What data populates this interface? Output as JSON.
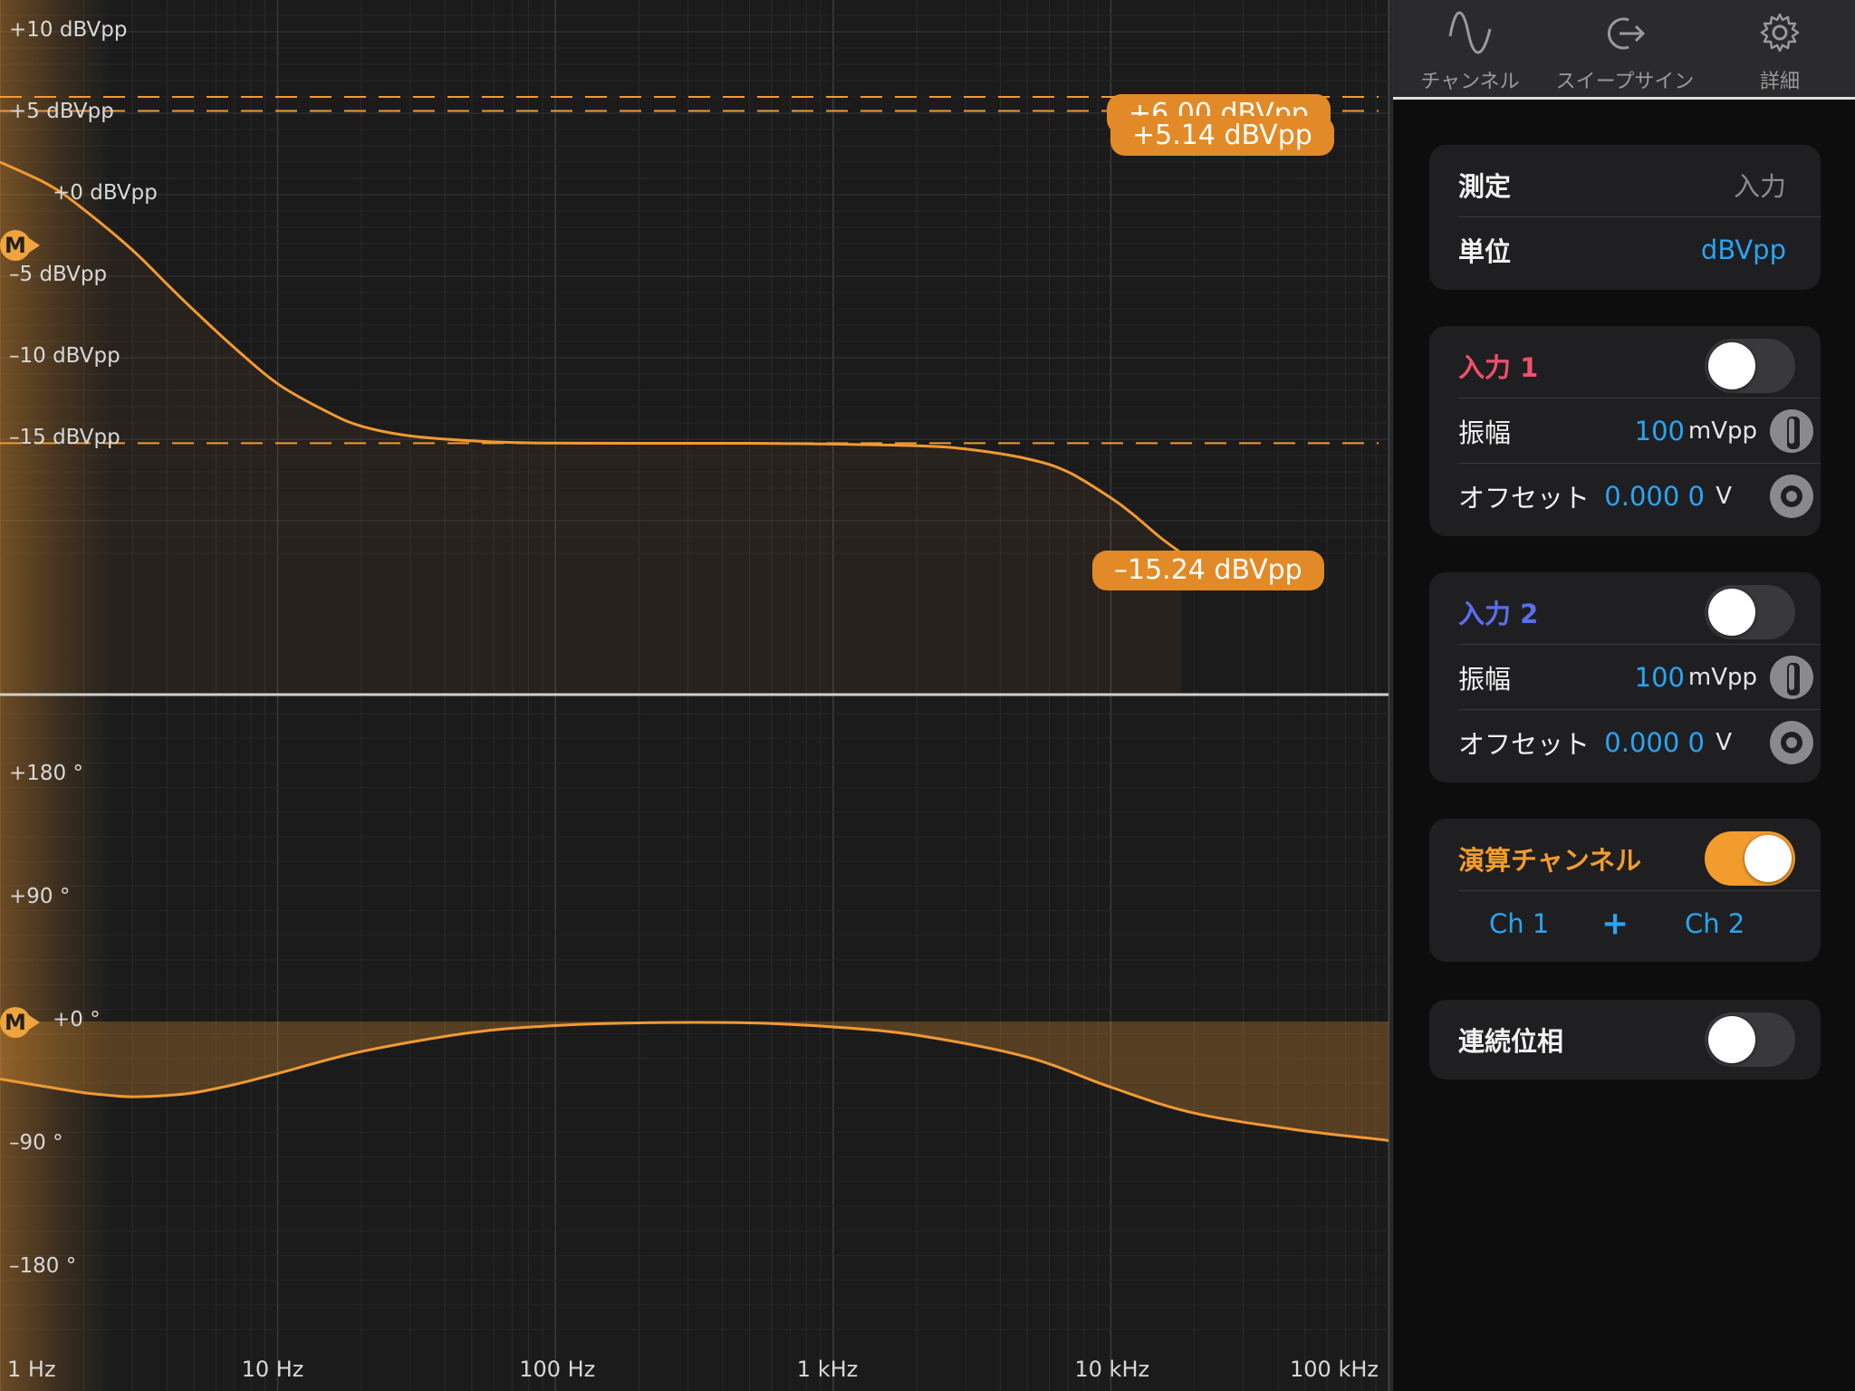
{
  "colors": {
    "accent": "#f39c2e",
    "curve": "#f29a32",
    "pill": "#e28a27",
    "input1": "#f0506e",
    "input2": "#5a6ef0",
    "value_blue": "#2aa4f4"
  },
  "tabs": [
    {
      "label": "チャンネル",
      "icon": "sine-wave-icon"
    },
    {
      "label": "スイープサイン",
      "icon": "sweep-export-icon"
    },
    {
      "label": "詳細",
      "icon": "gear-icon"
    }
  ],
  "measure": {
    "label": "測定",
    "value": "入力",
    "unit_label": "単位",
    "unit_value": "dBVpp"
  },
  "input1": {
    "title": "入力 1",
    "enabled": false,
    "amp_label": "振幅",
    "amp_value": "100",
    "amp_unit": "mVpp",
    "offset_label": "オフセット",
    "offset_value": "0.000 0",
    "offset_unit": "V"
  },
  "input2": {
    "title": "入力 2",
    "enabled": false,
    "amp_label": "振幅",
    "amp_value": "100",
    "amp_unit": "mVpp",
    "offset_label": "オフセット",
    "offset_value": "0.000 0",
    "offset_unit": "V"
  },
  "math": {
    "title": "演算チャンネル",
    "enabled": true,
    "ch_a": "Ch 1",
    "op": "+",
    "ch_b": "Ch 2"
  },
  "continuous_phase": {
    "label": "連続位相",
    "enabled": false
  },
  "markers": {
    "mag_marker": "M",
    "phase_marker": "M",
    "pill_top_hidden": "+6.00 dBVpp",
    "pill_top": "+5.14 dBVpp",
    "pill_mid": "–15.24 dBVpp"
  },
  "chart_data": [
    {
      "type": "line",
      "title": "",
      "xlabel": "",
      "ylabel": "",
      "x_scale": "log",
      "xlim": [
        1,
        150000
      ],
      "ylim": [
        -22,
        12
      ],
      "x_ticks": [
        "1 Hz",
        "10 Hz",
        "100 Hz",
        "1 kHz",
        "10 kHz",
        "100 kHz"
      ],
      "y_ticks": [
        "+10 dBVpp",
        "+5 dBVpp",
        "+0 dBVpp",
        "–5 dBVpp",
        "–10 dBVpp",
        "–15 dBVpp"
      ],
      "y_tick_values": [
        10,
        5,
        0,
        -5,
        -10,
        -15
      ],
      "reference_lines": [
        6.0,
        5.14,
        -15.24
      ],
      "series": [
        {
          "x": [
            1,
            1.5,
            2,
            3,
            4,
            5,
            7,
            10,
            15,
            20,
            30,
            50,
            70,
            100,
            200,
            500,
            1000,
            2000,
            3000,
            5000,
            7000,
            10000,
            12000,
            15000,
            18000
          ],
          "values": [
            2.0,
            0.6,
            -0.9,
            -3.4,
            -5.5,
            -7.1,
            -9.4,
            -11.6,
            -13.3,
            -14.2,
            -14.8,
            -15.1,
            -15.2,
            -15.24,
            -15.25,
            -15.25,
            -15.3,
            -15.4,
            -15.6,
            -16.2,
            -17.0,
            -18.6,
            -19.6,
            -21.0,
            -22.0
          ]
        }
      ]
    },
    {
      "type": "line",
      "title": "",
      "xlabel": "",
      "ylabel": "",
      "x_scale": "log",
      "xlim": [
        1,
        150000
      ],
      "ylim": [
        -225,
        225
      ],
      "x_ticks": [
        "1 Hz",
        "10 Hz",
        "100 Hz",
        "1 kHz",
        "10 kHz",
        "100 kHz"
      ],
      "y_ticks": [
        "+180 °",
        "+90 °",
        "+0 °",
        "–90 °",
        "–180 °"
      ],
      "y_tick_values": [
        180,
        90,
        0,
        -90,
        -180
      ],
      "series": [
        {
          "x": [
            1,
            1.5,
            2,
            2.5,
            3,
            4,
            5,
            7,
            10,
            20,
            50,
            100,
            200,
            500,
            1000,
            2000,
            5000,
            10000,
            20000,
            50000,
            100000,
            150000
          ],
          "values": [
            -42,
            -48,
            -52,
            -54,
            -55,
            -54,
            -52,
            -46,
            -38,
            -22,
            -8,
            -3,
            -1,
            -1,
            -4,
            -10,
            -26,
            -48,
            -67,
            -80,
            -87,
            -90
          ]
        }
      ]
    }
  ]
}
